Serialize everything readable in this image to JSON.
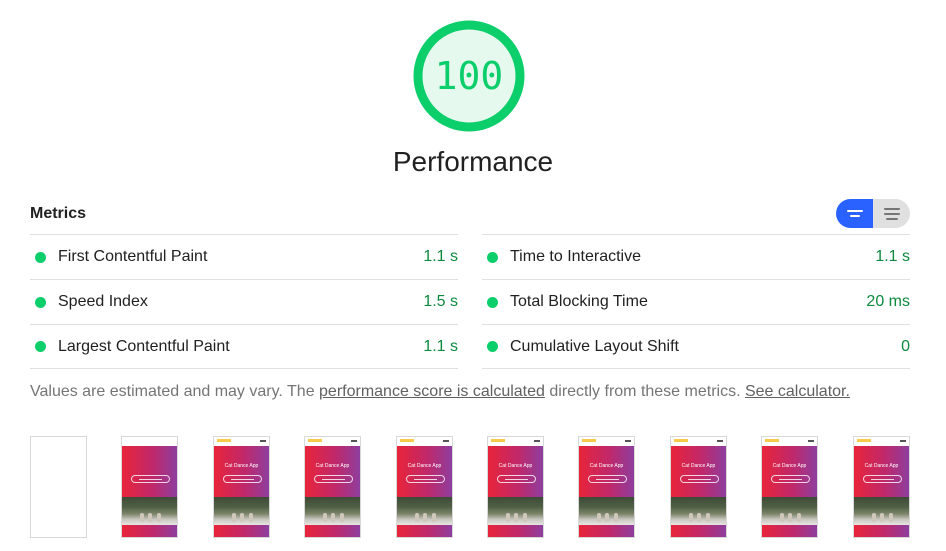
{
  "score": {
    "value": "100",
    "fraction": 1.0,
    "color": "#0cce6b",
    "track_color": "#e5f9ee"
  },
  "category": {
    "title": "Performance"
  },
  "metrics": {
    "title": "Metrics",
    "toggle": {
      "active_icon": "summary-view-icon",
      "inactive_icon": "description-view-icon",
      "active_color": "#2962ff"
    },
    "left": [
      {
        "name": "First Contentful Paint",
        "value": "1.1 s"
      },
      {
        "name": "Speed Index",
        "value": "1.5 s"
      },
      {
        "name": "Largest Contentful Paint",
        "value": "1.1 s"
      }
    ],
    "right": [
      {
        "name": "Time to Interactive",
        "value": "1.1 s"
      },
      {
        "name": "Total Blocking Time",
        "value": "20 ms"
      },
      {
        "name": "Cumulative Layout Shift",
        "value": "0"
      }
    ],
    "pass_color": "#0cce6b",
    "value_color": "#0c8a3e"
  },
  "note": {
    "prefix": "Values are estimated and may vary. The ",
    "link1": "performance score is calculated",
    "middle": " directly from these metrics. ",
    "link2": "See calculator."
  },
  "filmstrip": {
    "frames": [
      {
        "blank": true
      },
      {
        "blank": false,
        "title_bar": false,
        "app_title": ""
      },
      {
        "blank": false,
        "title_bar": true,
        "app_title": "Cat Dance App"
      },
      {
        "blank": false,
        "title_bar": true,
        "app_title": "Cat Dance App"
      },
      {
        "blank": false,
        "title_bar": true,
        "app_title": "Cat Dance App"
      },
      {
        "blank": false,
        "title_bar": true,
        "app_title": "Cat Dance App"
      },
      {
        "blank": false,
        "title_bar": true,
        "app_title": "Cat Dance App"
      },
      {
        "blank": false,
        "title_bar": true,
        "app_title": "Cat Dance App"
      },
      {
        "blank": false,
        "title_bar": true,
        "app_title": "Cat Dance App"
      },
      {
        "blank": false,
        "title_bar": true,
        "app_title": "Cat Dance App"
      }
    ]
  }
}
